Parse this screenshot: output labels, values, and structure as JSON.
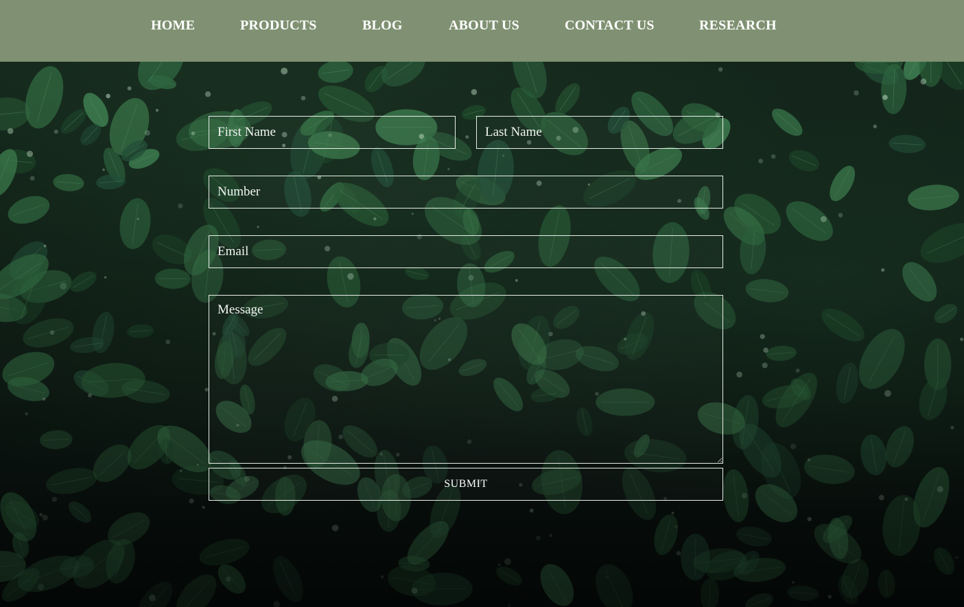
{
  "nav": {
    "items": [
      {
        "label": "HOME"
      },
      {
        "label": "PRODUCTS"
      },
      {
        "label": "BLOG"
      },
      {
        "label": "ABOUT US"
      },
      {
        "label": "CONTACT US"
      },
      {
        "label": "RESEARCH"
      }
    ]
  },
  "form": {
    "first_name_placeholder": "First Name",
    "last_name_placeholder": "Last Name",
    "number_placeholder": "Number",
    "email_placeholder": "Email",
    "message_placeholder": "Message",
    "submit_label": "SUBMIT"
  },
  "colors": {
    "navbar": "#7f9172",
    "nav_text": "#ffffff",
    "field_border": "#e9efe9",
    "background": "#0b1510",
    "leaf": "#2f6b3f"
  }
}
